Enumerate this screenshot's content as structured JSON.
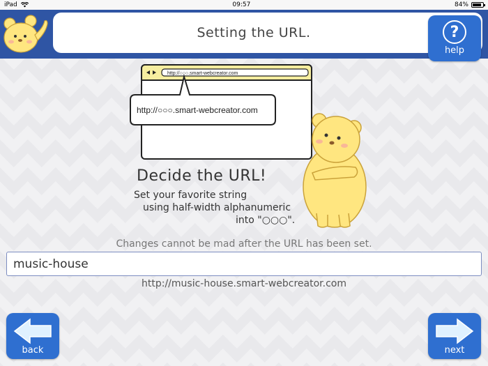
{
  "status_bar": {
    "device": "iPad",
    "time": "09:57",
    "battery": "84%",
    "battery_level": 0.84
  },
  "header": {
    "title": "Setting the URL.",
    "help_label": "help"
  },
  "illustration": {
    "address_bar_text": "http://○○○.smart-webcreator.com",
    "callout_text": "http://○○○.smart-webcreator.com"
  },
  "content": {
    "heading": "Decide the URL!",
    "instruction_line1": "Set your favorite string",
    "instruction_line2": "using half-width alphanumeric",
    "instruction_line3": "into \"○○○\".",
    "note": "Changes cannot be mad after the URL has been set.",
    "url_value": "music-house",
    "url_preview": "http://music-house.smart-webcreator.com"
  },
  "nav": {
    "back_label": "back",
    "next_label": "next"
  },
  "colors": {
    "header_blue": "#2f55a4",
    "button_blue": "#2f6fd0",
    "bear_yellow": "#ffe680",
    "browser_frame": "#f6eea0"
  }
}
